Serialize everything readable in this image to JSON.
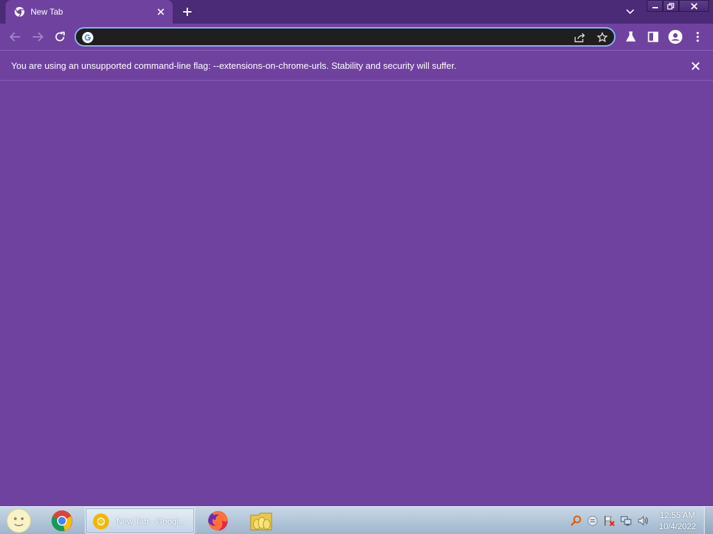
{
  "browser": {
    "tab": {
      "title": "New Tab"
    },
    "omnibox": {
      "value": "",
      "placeholder": ""
    },
    "infobar": {
      "message": "You are using an unsupported command-line flag: --extensions-on-chrome-urls. Stability and security will suffer."
    }
  },
  "taskbar": {
    "active_task_label": "New Tab - Googl...",
    "clock": {
      "time": "12:55 AM",
      "date": "10/4/2022"
    }
  },
  "icons": {
    "tab_favicon": "chrome-icon",
    "back": "back-arrow-icon",
    "forward": "forward-arrow-icon",
    "reload": "reload-icon",
    "share": "share-icon",
    "star": "star-icon",
    "labs": "flask-icon",
    "side_panel": "side-panel-icon",
    "profile": "profile-icon",
    "menu": "kebab-menu-icon"
  },
  "colors": {
    "theme_purple": "#6f42a0",
    "tabstrip": "#4b2a77",
    "omnibox_bg": "#1f1f1f",
    "omnibox_border": "#8ab4f8"
  }
}
